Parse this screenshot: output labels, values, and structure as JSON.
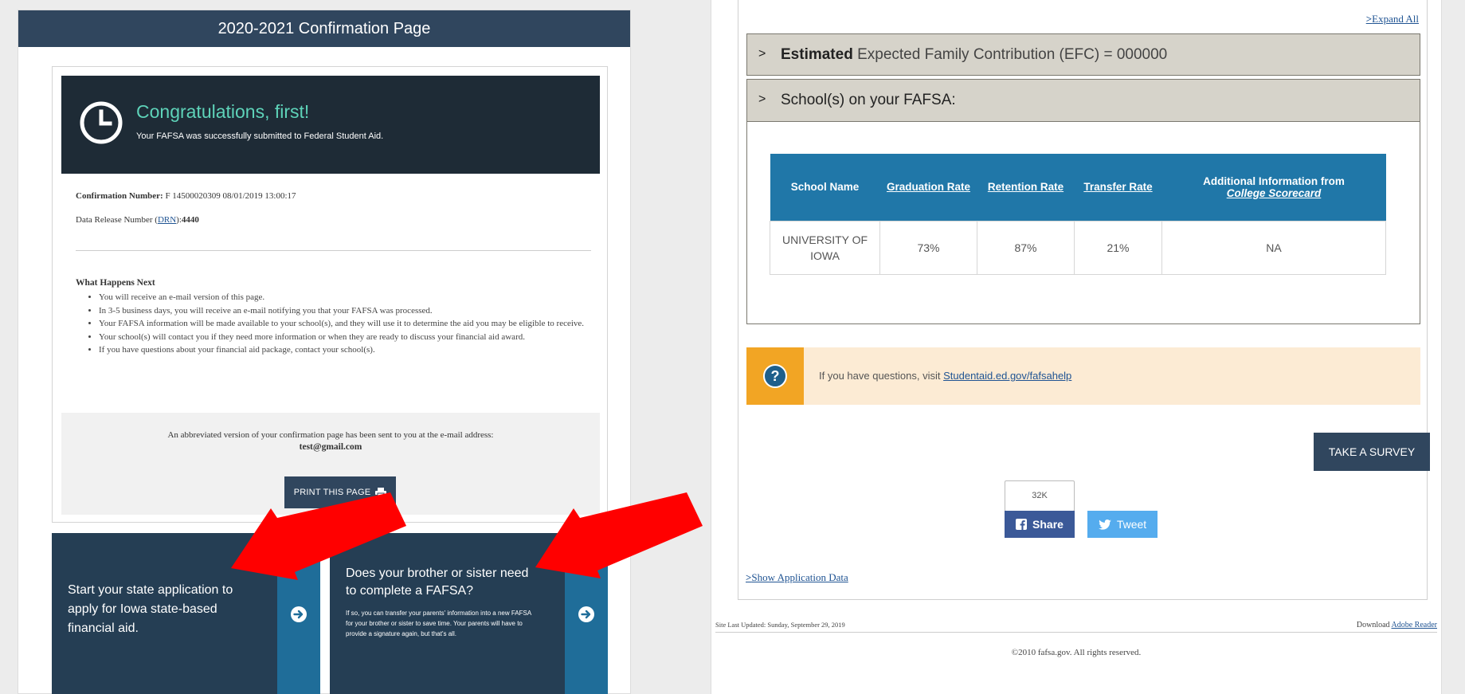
{
  "left": {
    "header_title": "2020-2021 Confirmation Page",
    "congrats_title": "Congratulations, first!",
    "congrats_subtitle": "Your FAFSA was successfully submitted to Federal Student Aid.",
    "confirmation_label": "Confirmation Number:",
    "confirmation_value": "F 14500020309 08/01/2019 13:00:17",
    "drn_prefix": "Data Release Number (",
    "drn_link": "DRN",
    "drn_suffix": "):",
    "drn_value": "4440",
    "next_heading": "What Happens Next",
    "next_items": [
      "You will receive an e-mail version of this page.",
      "In 3-5 business days, you will receive an e-mail notifying you that your FAFSA was processed.",
      "Your FAFSA information will be made available to your school(s), and they will use it to determine the aid you may be eligible to receive.",
      "Your school(s) will contact you if they need more information or when they are ready to discuss your financial aid award.",
      "If you have questions about your financial aid package, contact your school(s)."
    ],
    "email_message": "An abbreviated version of your confirmation page has been sent to you at the e-mail address:",
    "email_address": "test@gmail.com",
    "print_label": "PRINT THIS PAGE",
    "tile_state_text": "Start your state application to apply for Iowa state-based financial aid.",
    "tile_sibling_title": "Does your brother or sister need to complete a FAFSA?",
    "tile_sibling_body": "If so, you can transfer your parents' information into a new FAFSA for your brother or sister to save time. Your parents will have to provide a signature again, but that's all."
  },
  "right": {
    "expand_all": "Expand All",
    "efc_bold": "Estimated",
    "efc_rest": "Expected Family Contribution (EFC) = 000000",
    "schools_heading": "School(s) on your FAFSA:",
    "table": {
      "headers": [
        "School Name",
        "Graduation Rate",
        "Retention Rate",
        "Transfer Rate",
        "Additional Information from"
      ],
      "scorecard_link": "College Scorecard",
      "rows": [
        [
          "UNIVERSITY OF IOWA",
          "73%",
          "87%",
          "21%",
          "NA"
        ]
      ]
    },
    "help_prefix": "If you have questions, visit",
    "help_link": "Studentaid.ed.gov/fafsahelp",
    "survey_label": "TAKE A SURVEY",
    "share_count": "32K",
    "fb_label": "Share",
    "tw_label": "Tweet",
    "show_app_data": "Show Application Data",
    "site_updated": "Site Last Updated: Sunday, September 29, 2019",
    "download_prefix": "Download",
    "adobe_link": "Adobe Reader",
    "copyright": "©2010 fafsa.gov. All rights reserved."
  },
  "colors": {
    "navy": "#30465e",
    "banner_dark": "#1e2b36",
    "teal_title": "#5ed3b9",
    "table_blue": "#2077a8",
    "help_orange": "#f2a524",
    "arrow_red": "#ff0000"
  },
  "icons": [
    "clock-icon",
    "printer-icon",
    "arrow-circle-right-icon",
    "question-icon",
    "facebook-icon",
    "twitter-icon",
    "red-arrow"
  ]
}
